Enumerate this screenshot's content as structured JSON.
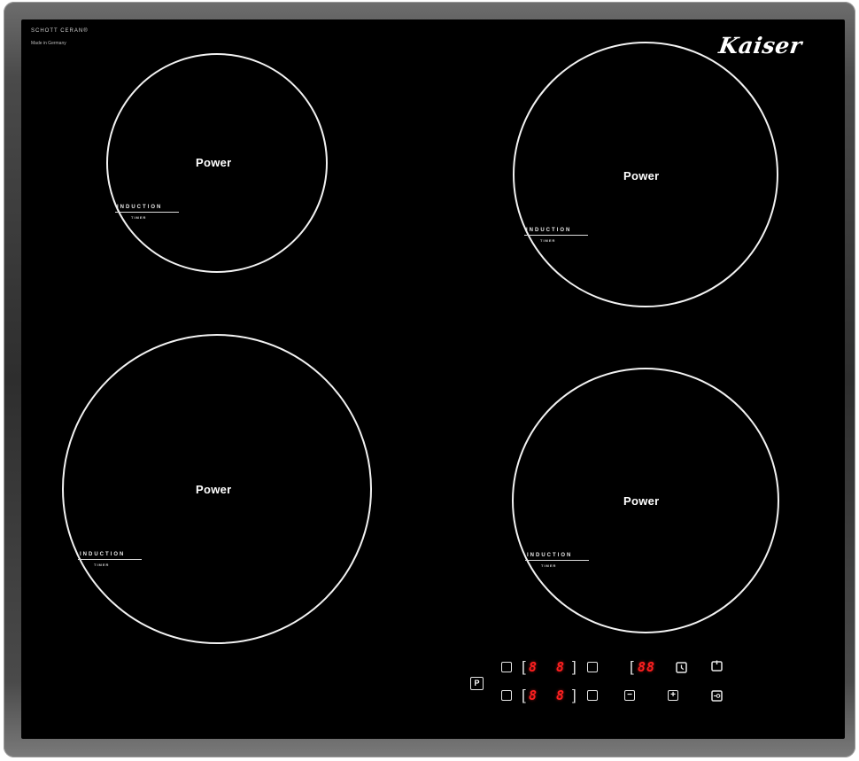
{
  "brand": {
    "glass_maker": "SCHOTT CERAN®",
    "made_in": "Made in Germany",
    "logo": "Kaiser"
  },
  "zones": [
    {
      "id": "top-left",
      "label": "Power",
      "induction": "INDUCTION",
      "timer": "TIMER"
    },
    {
      "id": "top-right",
      "label": "Power",
      "induction": "INDUCTION",
      "timer": "TIMER"
    },
    {
      "id": "bottom-left",
      "label": "Power",
      "induction": "INDUCTION",
      "timer": "TIMER"
    },
    {
      "id": "bottom-right",
      "label": "Power",
      "induction": "INDUCTION",
      "timer": "TIMER"
    }
  ],
  "controls": {
    "p_key": "P",
    "displays": {
      "row1_left": "8",
      "row1_right": "8",
      "row2_left": "8",
      "row2_right": "8",
      "timer": "88"
    },
    "minus_key": "−",
    "plus_key": "+",
    "icons": [
      "clock-icon",
      "power-icon",
      "lock-icon"
    ],
    "display_color": "#ff2020"
  }
}
